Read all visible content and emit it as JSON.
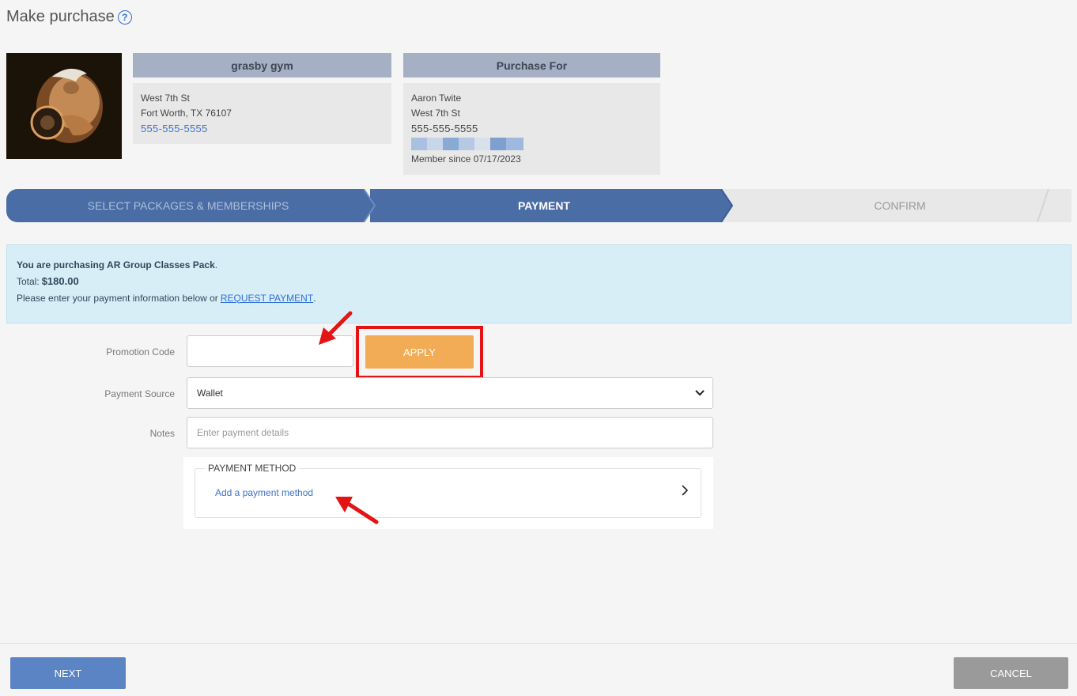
{
  "page": {
    "title": "Make purchase"
  },
  "gym": {
    "name": "grasby gym",
    "street": "West 7th St",
    "city": "Fort Worth, TX 76107",
    "phone": "555-555-5555"
  },
  "purchase_for": {
    "header": "Purchase For",
    "name": "Aaron Twite",
    "street": "West 7th St",
    "phone": "555-555-5555",
    "member_since": "Member since 07/17/2023"
  },
  "steps": [
    {
      "label": "SELECT PACKAGES & MEMBERSHIPS"
    },
    {
      "label": "PAYMENT"
    },
    {
      "label": "CONFIRM"
    }
  ],
  "info": {
    "purchasing_text": "You are purchasing AR Group Classes Pack",
    "total_label": "Total:",
    "total_value": "$180.00",
    "instruction": "Please enter your payment information below or",
    "request_link": "REQUEST PAYMENT"
  },
  "form": {
    "promo_label": "Promotion Code",
    "promo_value": "",
    "apply_label": "APPLY",
    "source_label": "Payment Source",
    "source_value": "Wallet",
    "notes_label": "Notes",
    "notes_placeholder": "Enter payment details"
  },
  "payment_method": {
    "legend": "PAYMENT METHOD",
    "link": "Add a payment method"
  },
  "footer": {
    "next_label": "NEXT",
    "cancel_label": "CANCEL"
  },
  "colors": {
    "step_active": "#4a6da6",
    "step_inactive": "#e8e8e8",
    "apply": "#f1ac55",
    "next": "#5a84c4",
    "highlight": "#e41414"
  }
}
